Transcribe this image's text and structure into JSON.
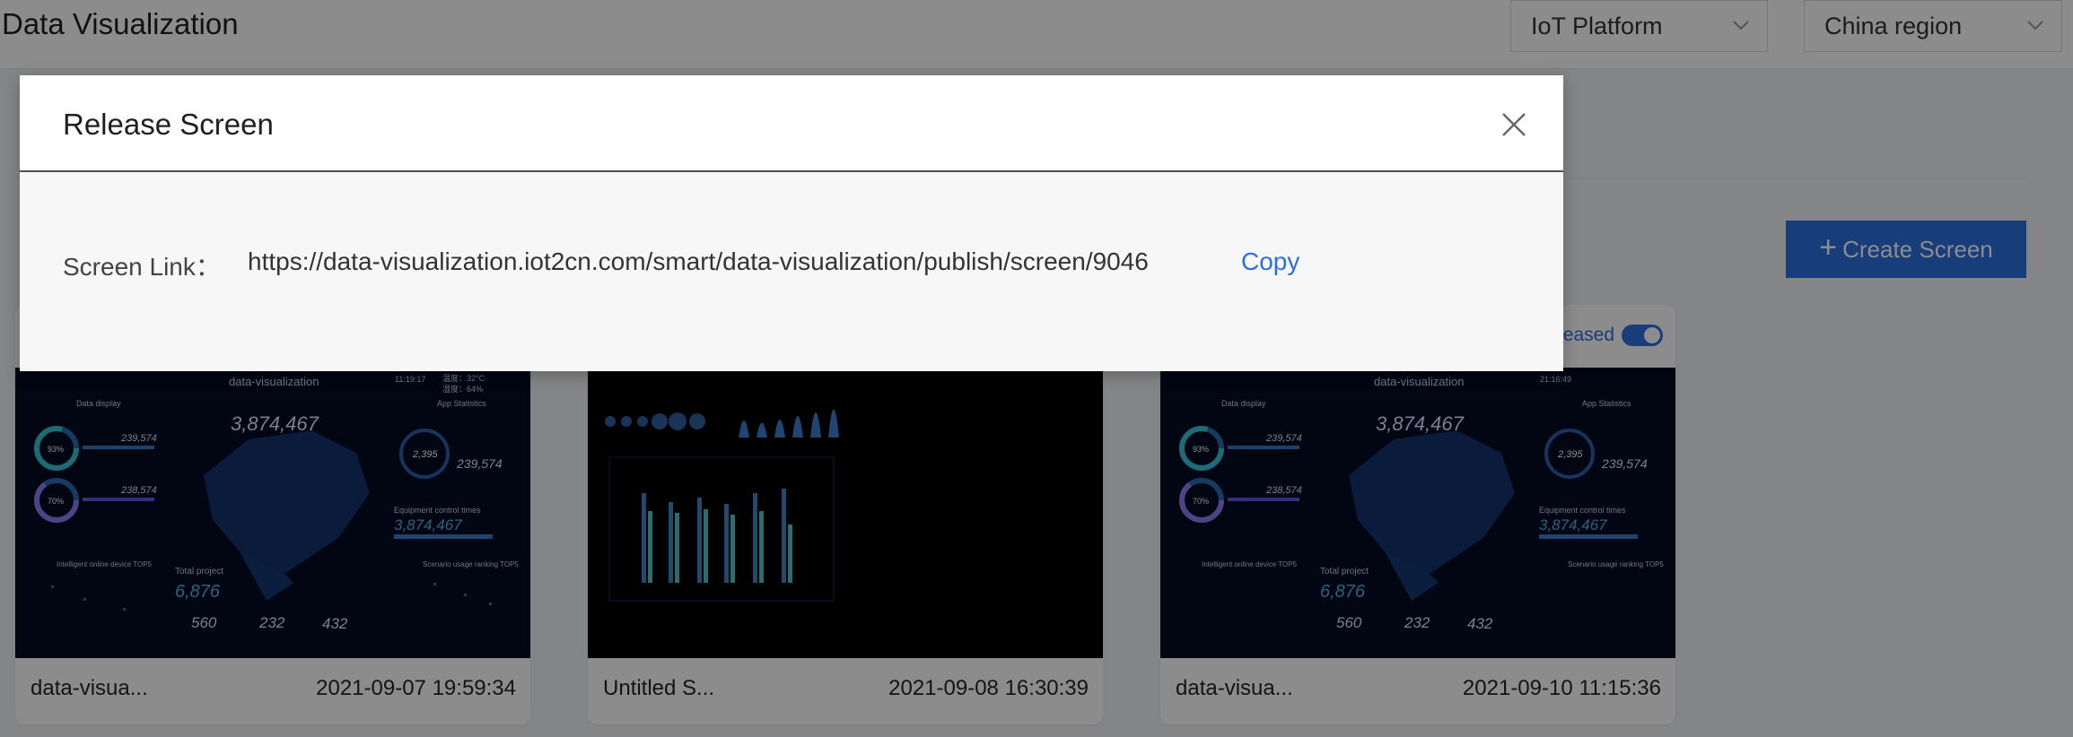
{
  "header": {
    "title": "Data Visualization",
    "product_select": "IoT Platform",
    "region_select": "China region"
  },
  "toolbar": {
    "create_plus": "+",
    "create_label": "Create Screen"
  },
  "cards": [
    {
      "name": "data-visua...",
      "time": "2021-09-07 19:59:34",
      "thumb": {
        "title": "data-visualization",
        "clock": "11:19:17",
        "weather_temp": "温度：32°C",
        "weather_humidity": "湿度：64%",
        "data_display": "Data display",
        "app_statistics": "App Statistics",
        "big_number": "3,874,467",
        "gauge1": "93%",
        "gauge2": "70%",
        "stat1": "239,574",
        "stat2": "238,574",
        "ring_value": "2,395",
        "sign_up": "239,574",
        "equipment_label": "Equipment control times",
        "equipment_value": "3,874,467",
        "top5_left": "Intelligent online device TOP5",
        "top5_right": "Scenario usage ranking TOP5",
        "total_project_label": "Total project",
        "total_project_value": "6,876",
        "n1": "560",
        "n2": "232",
        "n3": "432"
      }
    },
    {
      "name": "Untitled S...",
      "time": "2021-09-08 16:30:39"
    },
    {
      "name": "data-visua...",
      "time": "2021-09-10 11:15:36",
      "status": "Released",
      "thumb": {
        "title": "data-visualization",
        "clock": "21:16:49",
        "data_display": "Data display",
        "app_statistics": "App Statistics",
        "big_number": "3,874,467",
        "gauge1": "93%",
        "gauge2": "70%",
        "stat1": "239,574",
        "stat2": "238,574",
        "ring_value": "2,395",
        "sign_up": "239,574",
        "equipment_label": "Equipment control times",
        "equipment_value": "3,874,467",
        "top5_left": "Intelligent online device TOP5",
        "top5_right": "Scenario usage ranking TOP5",
        "total_project_label": "Total project",
        "total_project_value": "6,876",
        "n1": "560",
        "n2": "232",
        "n3": "432"
      }
    }
  ],
  "modal": {
    "title": "Release Screen",
    "link_label": "Screen Link：",
    "link_url": "https://data-visualization.iot2cn.com/smart/data-visualization/publish/screen/9046",
    "copy_label": "Copy"
  },
  "colors": {
    "primary": "#2c6fe0",
    "overlay": "rgba(0,0,0,0.45)",
    "dashboard_bg": "#050b24"
  }
}
